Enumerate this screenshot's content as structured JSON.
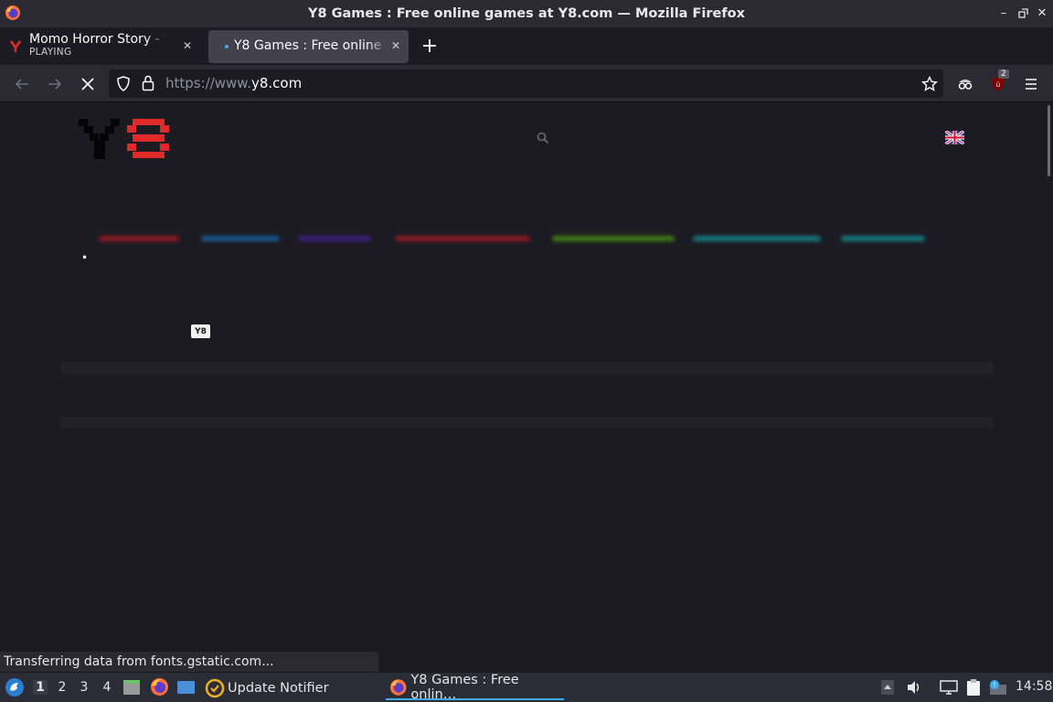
{
  "window": {
    "title": "Y8 Games : Free online games at Y8.com — Mozilla Firefox",
    "controls": [
      "minimize",
      "restore",
      "close"
    ]
  },
  "tabs": [
    {
      "label": "Momo Horror Story - Y",
      "sublabel": "PLAYING",
      "icon": "y8-favicon-icon",
      "active": false
    },
    {
      "label": "Y8 Games : Free online",
      "sublabel": "",
      "icon": "loading-dot-icon",
      "active": true
    }
  ],
  "navbar": {
    "url_prefix": "https://www.",
    "url_domain": "y8.com",
    "extension_badge": "2"
  },
  "page": {
    "logo_text": "Y8",
    "small_logo_text": "Y8",
    "bullet": "•",
    "glow_colors": [
      "#c81e2a",
      "#1e8ad2",
      "#6b2ab4",
      "#c81e2a",
      "#5aaa1e",
      "#1eaab4",
      "#1eaab4"
    ]
  },
  "status_text": "Transferring data from fonts.gstatic.com...",
  "taskbar": {
    "workspaces": [
      "1",
      "2",
      "3",
      "4"
    ],
    "tasks": [
      {
        "label": "Update Notifier",
        "icon": "update-notifier-icon"
      },
      {
        "label": "Y8 Games : Free onlin…",
        "icon": "firefox-icon"
      }
    ],
    "clock": "14:58"
  }
}
